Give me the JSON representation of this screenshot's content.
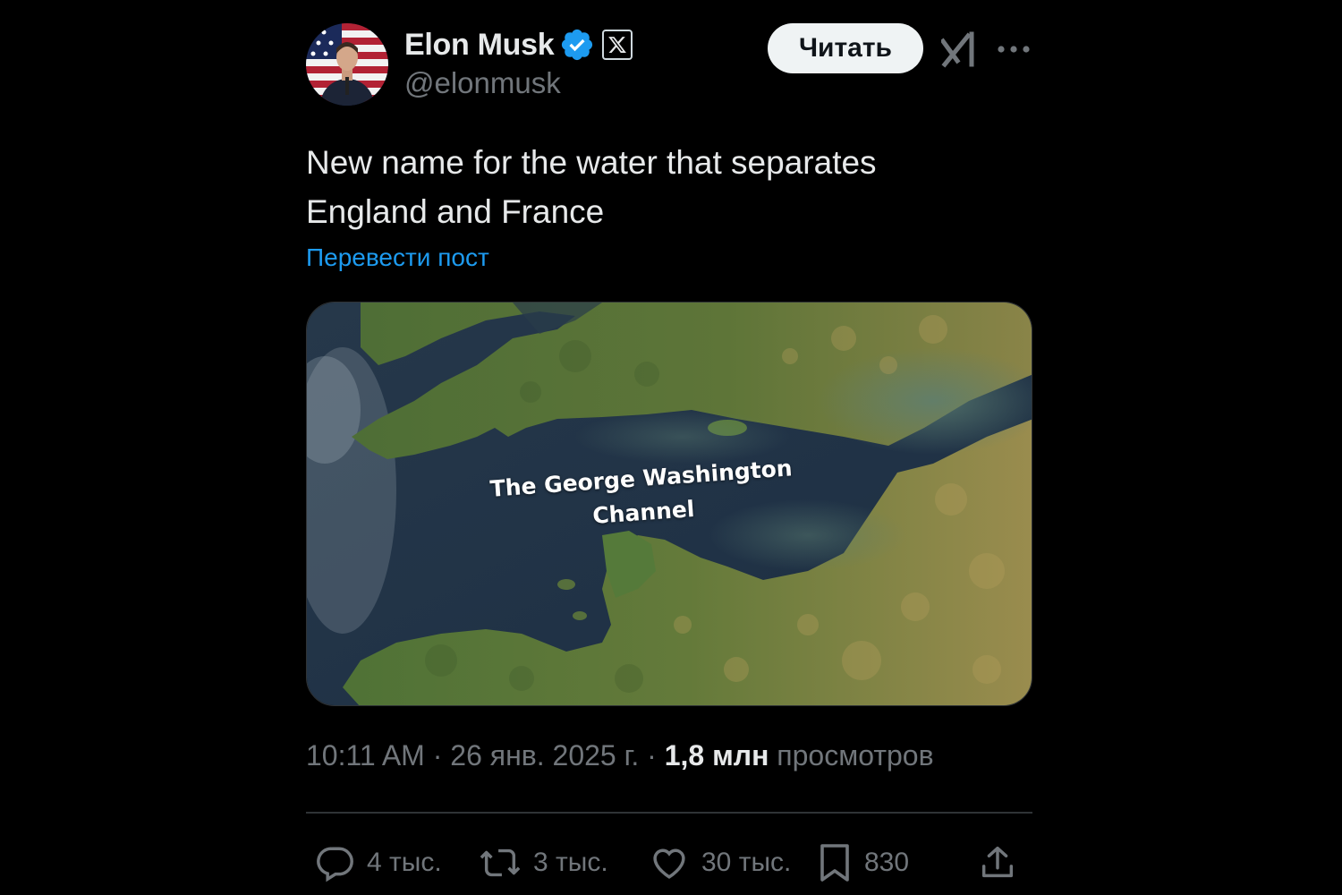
{
  "author": {
    "display_name": "Elon Musk",
    "handle": "@elonmusk",
    "verified_icon": "verified-badge-icon",
    "affiliation_icon": "x-logo-icon",
    "avatar_icon": "user-avatar"
  },
  "header": {
    "follow_label": "Читать",
    "grok_icon": "grok-icon",
    "more_icon": "more-dots-icon"
  },
  "post": {
    "text_line1": "New name for the water that separates",
    "text_line2": "England and France",
    "translate_label": "Перевести пост",
    "image_caption": "The George Washington Channel"
  },
  "meta": {
    "time": "10:11 AM",
    "separator": "·",
    "date": "26 янв. 2025 г.",
    "views_count": "1,8 млн",
    "views_label": "просмотров"
  },
  "actions": {
    "reply_count": "4 тыс.",
    "repost_count": "3 тыс.",
    "like_count": "30 тыс.",
    "bookmark_count": "830"
  },
  "colors": {
    "background": "#000000",
    "text_primary": "#e7e9ea",
    "text_secondary": "#71767b",
    "link": "#1d9bf0",
    "verified": "#1d9bf0",
    "divider": "#2f3336"
  }
}
